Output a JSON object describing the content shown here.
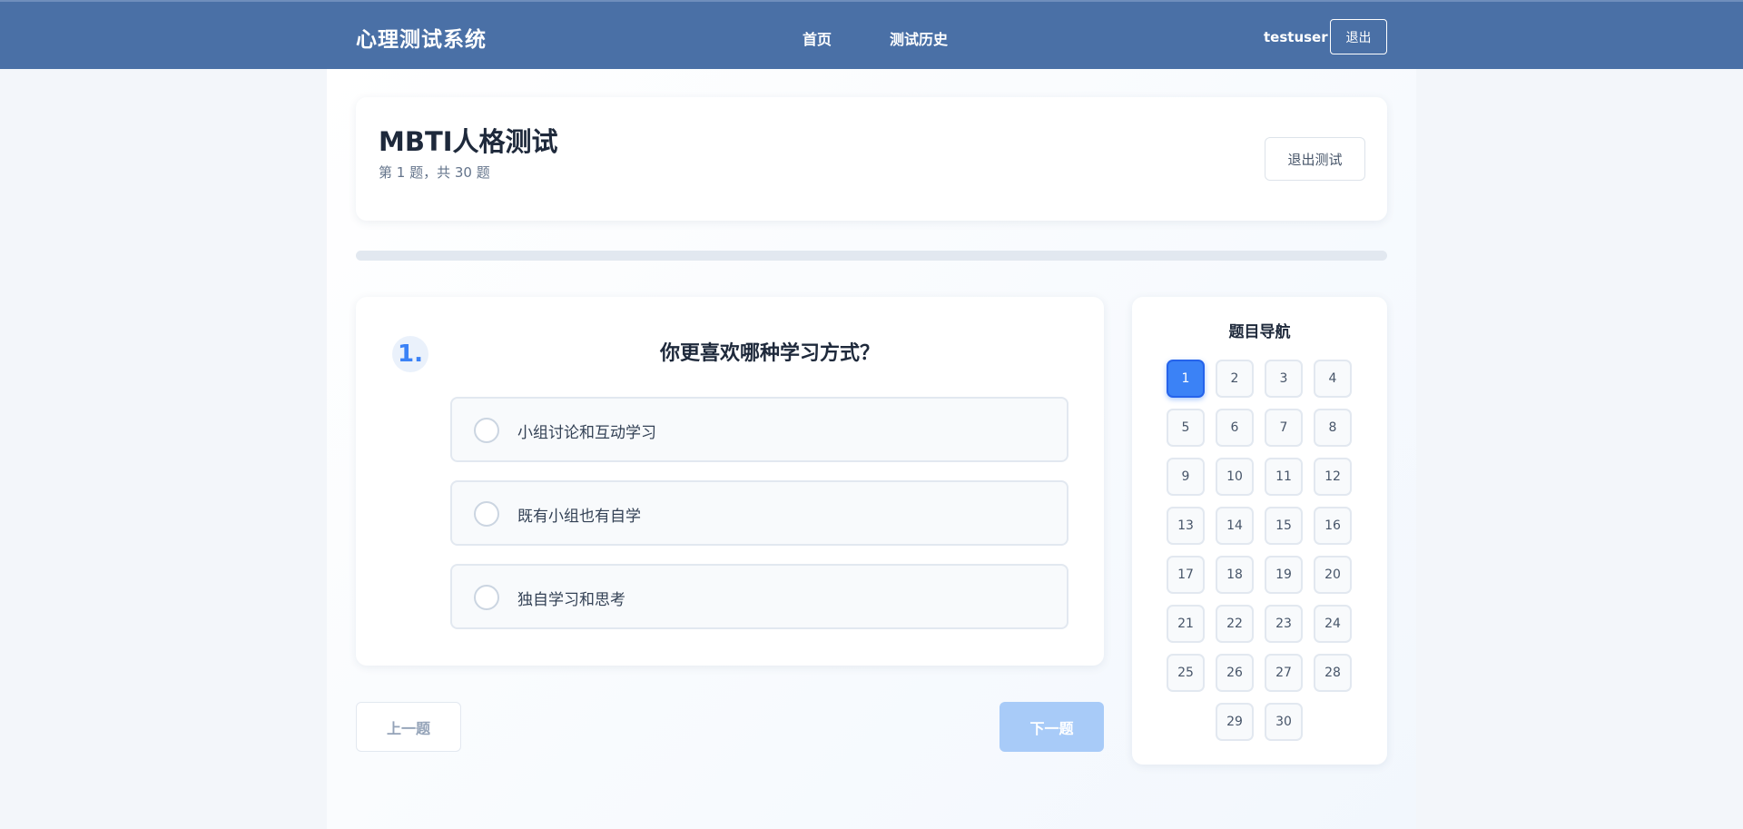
{
  "navbar": {
    "brand": "心理测试系统",
    "links": [
      "首页",
      "测试历史"
    ],
    "username": "testuser",
    "logout_label": "退出"
  },
  "test": {
    "title": "MBTI人格测试",
    "progress_text": "第 1 题，共 30 题",
    "exit_label": "退出测试",
    "progress_fraction": 0
  },
  "question": {
    "number": "1.",
    "text": "你更喜欢哪种学习方式？",
    "options": [
      "小组讨论和互动学习",
      "既有小组也有自学",
      "独自学习和思考"
    ]
  },
  "footer_buttons": {
    "prev_label": "上一题",
    "next_label": "下一题"
  },
  "question_nav": {
    "title": "题目导航",
    "current": 1,
    "items": [
      "1",
      "2",
      "3",
      "4",
      "5",
      "6",
      "7",
      "8",
      "9",
      "10",
      "11",
      "12",
      "13",
      "14",
      "15",
      "16",
      "17",
      "18",
      "19",
      "20",
      "21",
      "22",
      "23",
      "24",
      "25",
      "26",
      "27",
      "28",
      "29",
      "30"
    ]
  },
  "colors": {
    "navbar": "#4a70a6",
    "accent": "#3b82f6",
    "next_disabled": "#a8cbf8"
  }
}
